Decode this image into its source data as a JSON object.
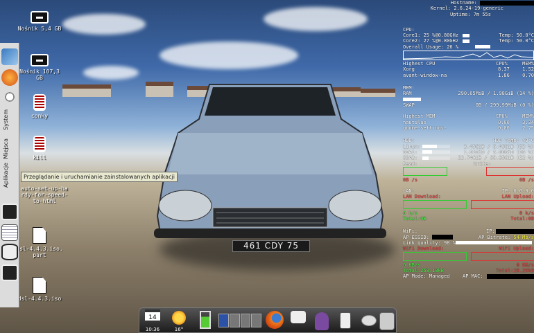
{
  "desktop": {
    "icons": [
      {
        "label": "Nośnik 5,4 GB",
        "icon": "drive-icon"
      },
      {
        "label": "Nośnik 107,3 GB",
        "icon": "drive-icon"
      },
      {
        "label": "conky",
        "icon": "spring-icon"
      },
      {
        "label": "kill",
        "icon": "spring-icon"
      },
      {
        "label": "auto-set-up-hardy-for-speed-to-html",
        "icon": "file-icon"
      },
      {
        "label": "dsl-4.4.3.iso.part",
        "icon": "file-icon"
      },
      {
        "label": "dsl-4.4.3.iso",
        "icon": "file-icon"
      }
    ],
    "plate_text": "461 CDY 75"
  },
  "left_panel": {
    "labels": [
      "Aplikacje",
      "Miejsca",
      "System"
    ],
    "tooltip": "Przeglądanie i uruchamianie zainstalowanych aplikacji"
  },
  "conky": {
    "hostname_label": "Hostname:",
    "kernel": "Kernel: 2.6.24-19-generic",
    "uptime": "Uptime: 7m 55s",
    "cpu": {
      "title": "CPU:",
      "core1": "Core1:  25 %@0.80GHz",
      "core1_temp": "Temp: 50.0°C",
      "core2": "Core2:  27 %@0.80GHz",
      "core2_temp": "Temp: 50.0°C",
      "overall": "Overall Usage:  26 %",
      "overall_pct": 0.26
    },
    "highest_cpu": {
      "title": "Highest CPU",
      "col1": "CPU%",
      "col2": "MEM%",
      "rows": [
        {
          "name": "Xorg",
          "cpu": "8.37",
          "mem": "1.52"
        },
        {
          "name": "avant-window-na",
          "cpu": "1.86",
          "mem": "0.70"
        }
      ]
    },
    "mem": {
      "title": "MEM:",
      "ram_label": "RAM",
      "ram_value": "290.65MiB / 1.98GiB  (14 %)",
      "ram_pct": 0.14,
      "swap_label": "SWAP",
      "swap_value": "0B   / 299.99MiB (0  %)",
      "swap_pct": 0.0
    },
    "highest_mem": {
      "title": "Highest MEM",
      "col1": "CPU%",
      "col2": "MEM%",
      "rows": [
        {
          "name": "nautilus",
          "cpu": "0.00",
          "mem": "3.34"
        },
        {
          "name": "gnome-settings-",
          "cpu": "0.00",
          "mem": "2.75"
        }
      ]
    },
    "hdd": {
      "title": "HDD:",
      "temp": "HDD Temp: 43°C",
      "rows": [
        {
          "name": "Linux:",
          "value": "3.45GiB  /  6.49GiB  (53 %)",
          "pct": 0.53
        },
        {
          "name": "SDA1:",
          "value": "1.81GiB  /  5.00GiB  (36 %)",
          "pct": 0.36
        },
        {
          "name": "SDA2:",
          "value": "22.74GiB  /  99.95GiB  (22 %)",
          "pct": 0.22
        }
      ],
      "read": "Read:",
      "write": "Write:",
      "read_val": "0B   /s",
      "write_val": "0B   /s"
    },
    "lan": {
      "title": "LAN:",
      "ip": "IP: 0.0.0.0",
      "download": "LAN Download:",
      "upload": "LAN Upload:",
      "down_rate": "0   k/s",
      "up_rate": "0   k/s",
      "down_total": "Total:0B",
      "up_total": "Total:0B"
    },
    "wifi": {
      "title": "WiFi:",
      "ip": "IP:",
      "essid": "AP ESSID:",
      "bitrate_label": "AP Bitrate:",
      "bitrate": "54 Mb/s",
      "quality": "Link quality: 98  %",
      "quality_pct": 0.98,
      "download": "WiFi Download:",
      "upload": "WiFi Upload:",
      "down_rate": "0   KB/s",
      "up_rate": "0   KB/s",
      "down_total": "Total:253.13kB",
      "up_total": "Total:28.29kB",
      "mode": "AP Mode: Managed",
      "mac": "AP MAC:"
    }
  },
  "dock": {
    "date_month": "PAZ",
    "date_day": "14",
    "clock": "10:36",
    "weather_temp": "16°"
  },
  "colors": {
    "graph_green": "#33cc33",
    "graph_red": "#dd3333",
    "highlight_yellow": "#ffff33",
    "panel_bg": "#dcdcdc"
  }
}
